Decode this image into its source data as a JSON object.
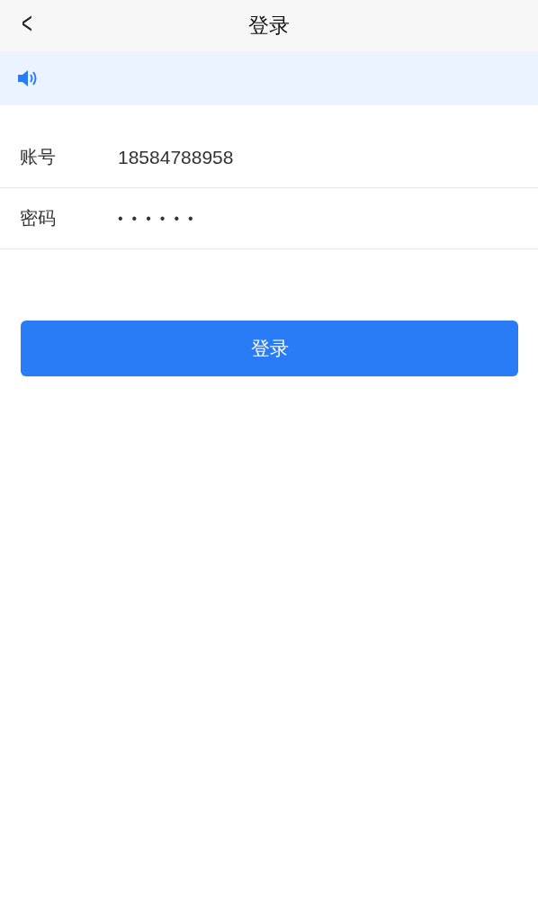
{
  "header": {
    "back": "<",
    "title": "登录"
  },
  "notice": {
    "visible": true
  },
  "fields": [
    {
      "label": "账号",
      "value": "18584788958",
      "kind": "text"
    },
    {
      "label": "密码",
      "value": "••••••",
      "kind": "password"
    }
  ],
  "button": {
    "label": "登录"
  }
}
